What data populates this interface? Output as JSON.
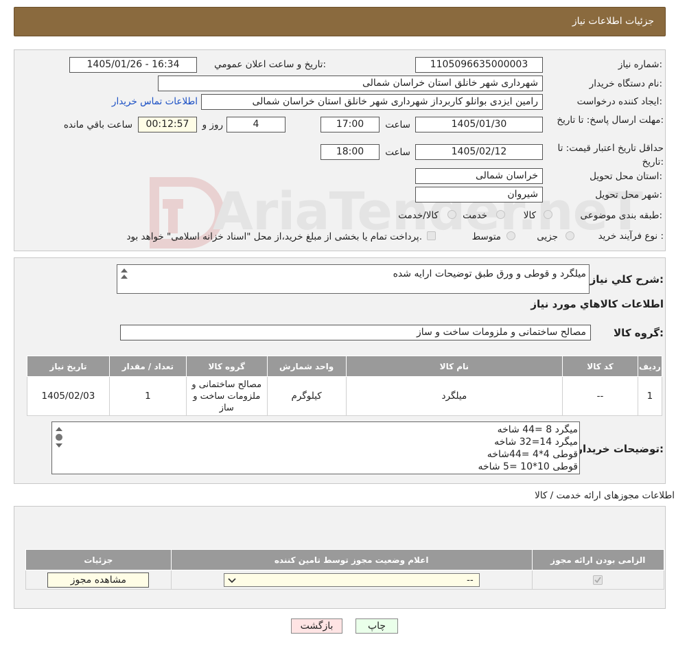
{
  "header": {
    "title": "جزئیات اطلاعات نیاز"
  },
  "info": {
    "need_number_label": "شماره نیاز:",
    "need_number": "1105096635000003",
    "announce_label": "تاریخ و ساعت اعلان عمومي:",
    "announce_value": "1405/01/26 - 16:34",
    "buyer_org_label": "نام دستگاه خريدار:",
    "buyer_org": "شهرداری شهر خانلق استان خراسان شمالی",
    "requester_label": "ايجاد كننده درخواست:",
    "requester": "رامین ایزدی بوانلو کاربرداز شهرداری شهر خانلق استان خراسان شمالی",
    "contact_link": "اطلاعات تماس خريدار",
    "reply_deadline_label": "مهلت ارسال پاسخ: تا تاريخ:",
    "reply_date": "1405/01/30",
    "time_label": "ساعت",
    "reply_time": "17:00",
    "days": "4",
    "days_label": "روز و",
    "remaining": "00:12:57",
    "remaining_label": "ساعت باقي مانده",
    "price_valid_label": "حداقل تاريخ اعتبار قيمت: تا تاريخ:",
    "price_date": "1405/02/12",
    "price_time": "18:00",
    "province_label": "استان محل تحويل:",
    "province": "خراسان شمالی",
    "city_label": "شهر محل تحويل:",
    "city": "شیروان",
    "category_label": "طبقه بندی موضوعی:",
    "category_options": [
      "کالا",
      "خدمت",
      "کالا/خدمت"
    ],
    "process_label": "نوع فرآيند خريد :",
    "process_options": [
      "جزیی",
      "متوسط"
    ],
    "process_note": "پرداخت تمام یا بخشی از مبلغ خرید،از محل \"اسناد خزانه اسلامی\" خواهد بود."
  },
  "desc": {
    "summary_label": "شرح کلي نياز:",
    "summary": "میلگرد و قوطی و ورق طبق توضیحات ارایه شده",
    "goods_title": "اطلاعات کالاهاي مورد نياز",
    "group_label": "گروه کالا:",
    "group_value": "مصالح ساختمانی و ملزومات ساخت و ساز",
    "table_headers": [
      "رديف",
      "کد کالا",
      "نام کالا",
      "واحد شمارش",
      "گروه کالا",
      "تعداد / مقدار",
      "تاريخ نياز"
    ],
    "rows": [
      [
        "1",
        "--",
        "میلگرد",
        "کیلوگرم",
        "مصالح ساختمانی و ملزومات ساخت و ساز",
        "1",
        "1405/02/03"
      ]
    ],
    "buyer_notes_label": "توضيحات خريدار:",
    "buyer_notes": [
      "میگرد 8 =44 شاخه",
      "میگرد 14=32 شاخه",
      "قوطی 4*4 =44شاخه",
      "قوطی 10*10 =5 شاخه"
    ]
  },
  "permits": {
    "title": "اطلاعات مجوزهای ارائه خدمت / کالا",
    "headers": [
      "الزامی بودن ارائه مجوز",
      "اعلام وضعیت مجوز توسط تامین کننده",
      "جزئیات"
    ],
    "select_value": "--",
    "view_button": "مشاهده مجوز"
  },
  "footer": {
    "back_button": "بازگشت",
    "print_button": "چاپ"
  },
  "watermark": {
    "text": "AriaTender.neT"
  }
}
